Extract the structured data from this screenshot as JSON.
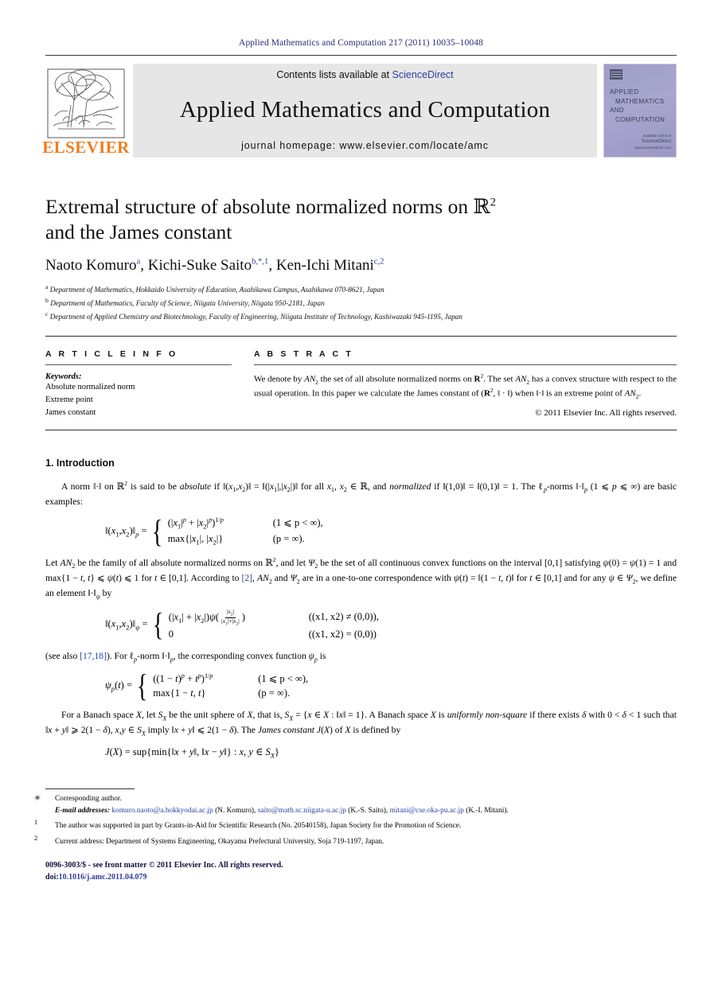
{
  "running_head": "Applied Mathematics and Computation 217 (2011) 10035–10048",
  "masthead": {
    "contents_prefix": "Contents lists available at ",
    "sciencedirect": "ScienceDirect",
    "journal_name": "Applied Mathematics and Computation",
    "homepage": "journal homepage: www.elsevier.com/locate/amc",
    "publisher": "ELSEVIER",
    "cover": {
      "line1": "APPLIED",
      "line2": "MATHEMATICS",
      "line3": "AND",
      "line4": "COMPUTATION",
      "badge_small": "available online at",
      "badge_big": "ScienceDirect",
      "badge_url": "www.sciencedirect.com"
    },
    "accent_link_color": "#2b3fa0",
    "elsevier_orange": "#ef7d1a",
    "band_bg": "#e6e6e6"
  },
  "article": {
    "title_line1": "Extremal structure of absolute normalized norms on ",
    "title_symbol": "ℝ",
    "title_exponent": "2",
    "title_line2": "and the James constant",
    "authors": [
      {
        "name": "Naoto Komuro",
        "marks": "a"
      },
      {
        "name": "Kichi-Suke Saito",
        "marks": "b,*,1"
      },
      {
        "name": "Ken-Ichi Mitani",
        "marks": "c,2"
      }
    ],
    "authors_plain": "Naoto Komuro a, Kichi-Suke Saito b,*,1, Ken-Ichi Mitani c,2",
    "affiliations": [
      {
        "mark": "a",
        "text": "Department of Mathematics, Hokkaido University of Education, Asahikawa Campus, Asahikawa 070-8621, Japan"
      },
      {
        "mark": "b",
        "text": "Department of Mathematics, Faculty of Science, Niigata University, Niigata 950-2181, Japan"
      },
      {
        "mark": "c",
        "text": "Department of Applied Chemistry and Biotechnology, Faculty of Engineering, Niigata Institute of Technology, Kashiwazaki 945-1195, Japan"
      }
    ]
  },
  "article_info": {
    "heading": "A R T I C L E   I N F O",
    "keywords_label": "Keywords:",
    "keywords": [
      "Absolute normalized norm",
      "Extreme point",
      "James constant"
    ]
  },
  "abstract": {
    "heading": "A B S T R A C T",
    "text": "We denote by AN2 the set of all absolute normalized norms on R2. The set AN2 has a convex structure with respect to the usual operation. In this paper we calculate the James constant of (R2, ‖ · ‖) when ‖·‖ is an extreme point of AN2.",
    "copyright": "© 2011 Elsevier Inc. All rights reserved."
  },
  "sections": {
    "intro_heading": "1. Introduction",
    "p1": "A norm ‖·‖ on R2 is said to be absolute if ‖(x1,x2)‖ = ‖(|x1|,|x2|)‖ for all x1, x2 ∈ R, and normalized if ‖(1,0)‖ = ‖(0,1)‖ = 1. The ℓp-norms ‖·‖p (1 ⩽ p ⩽ ∞) are basic examples:",
    "eq1": {
      "lhs": "‖(x1, x2)‖p =",
      "row1_lhs": "(|x1|p + |x2|p)1/p",
      "row1_rhs": "(1 ⩽ p < ∞),",
      "row2_lhs": "max{|x1|, |x2|}",
      "row2_rhs": "(p = ∞)."
    },
    "p2": "Let AN2 be the family of all absolute normalized norms on R2, and let Ψ2 be the set of all continuous convex functions on the interval [0,1] satisfying ψ(0) = ψ(1) = 1 and max{1 − t, t} ⩽ ψ(t) ⩽ 1 for t ∈ [0,1]. According to [2], AN2 and Ψ2 are in a one-to-one correspondence with ψ(t) = ‖(1 − t, t)‖ for t ∈ [0,1] and for any ψ ∈ Ψ2, we define an element ‖·‖ψ by",
    "p2_ref": "[2]",
    "eq2": {
      "lhs": "‖(x1, x2)‖ψ =",
      "row1_rhs": "((x1, x2) ≠ (0,0)),",
      "row2_lhs": "0",
      "row2_rhs": "((x1, x2) = (0,0))"
    },
    "p3_pre": "(see also ",
    "p3_ref": "[17,18]",
    "p3_post": "). For ℓp-norm ‖·‖p, the corresponding convex function ψp is",
    "eq3": {
      "lhs": "ψp(t) =",
      "row1_lhs": "((1 − t)p + tp)1/p",
      "row1_rhs": "(1 ⩽ p < ∞),",
      "row2_lhs": "max{1 − t, t}",
      "row2_rhs": "(p = ∞)."
    },
    "p4": "For a Banach space X, let SX be the unit sphere of X, that is, SX = {x ∈ X : ‖x‖ = 1}. A Banach space X is uniformly non-square if there exists δ with 0 < δ < 1 such that ‖x + y‖ ⩾ 2(1 − δ), x,y ∈ SX imply ‖x + y‖ ⩽ 2(1 − δ). The James constant J(X) of X is defined by",
    "eq4": "J(X) = sup{min{‖x + y‖, ‖x − y‖} : x, y ∈ SX}"
  },
  "footnotes": {
    "corresponding": "Corresponding author.",
    "email_label": "E-mail addresses:",
    "emails": [
      {
        "address": "komuro.naoto@a.hokkyodai.ac.jp",
        "who": "(N. Komuro)"
      },
      {
        "address": "saito@math.sc.niigata-u.ac.jp",
        "who": "(K.-S. Saito)"
      },
      {
        "address": "mitani@cse.oka-pu.ac.jp",
        "who": "(K.-I. Mitani)"
      }
    ],
    "note1_mark": "1",
    "note1": "The author was supported in part by Grants-in-Aid for Scientific Research (No. 20540158), Japan Society for the Promotion of Science.",
    "note2_mark": "2",
    "note2": "Current address: Department of Systems Engineering, Okayama Prefectural University, Soja 719-1197, Japan."
  },
  "imprint": {
    "issn_line": "0096-3003/$ - see front matter © 2011 Elsevier Inc. All rights reserved.",
    "doi_label": "doi:",
    "doi_value": "10.1016/j.amc.2011.04.079"
  }
}
